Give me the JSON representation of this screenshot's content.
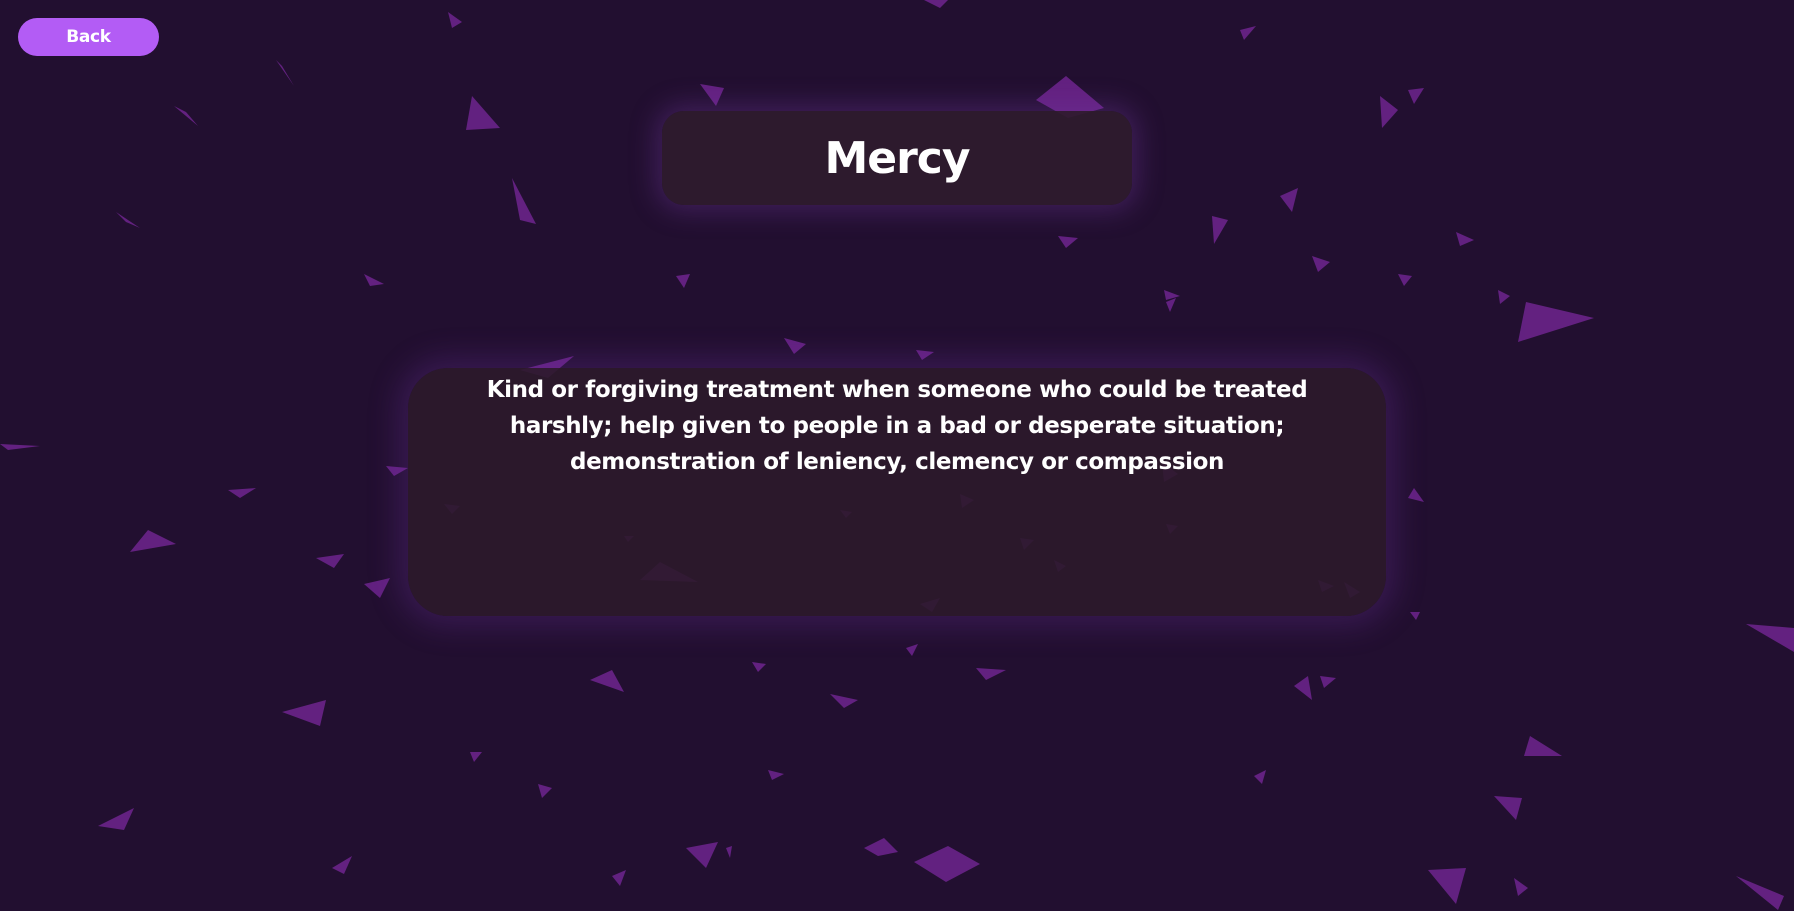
{
  "navigation": {
    "back_label": "Back"
  },
  "word": {
    "title": "Mercy",
    "definition": "Kind or forgiving treatment when someone who could be treated harshly; help given to people in a bad or desperate situation; demonstration of leniency, clemency or compassion"
  },
  "theme": {
    "background": "#220f30",
    "confetti": "#6a2389",
    "button": "#b35cf5",
    "card": "#2c1a2b",
    "text": "#ffffff"
  },
  "icons": {
    "confetti": "confetti-shard-icon"
  }
}
